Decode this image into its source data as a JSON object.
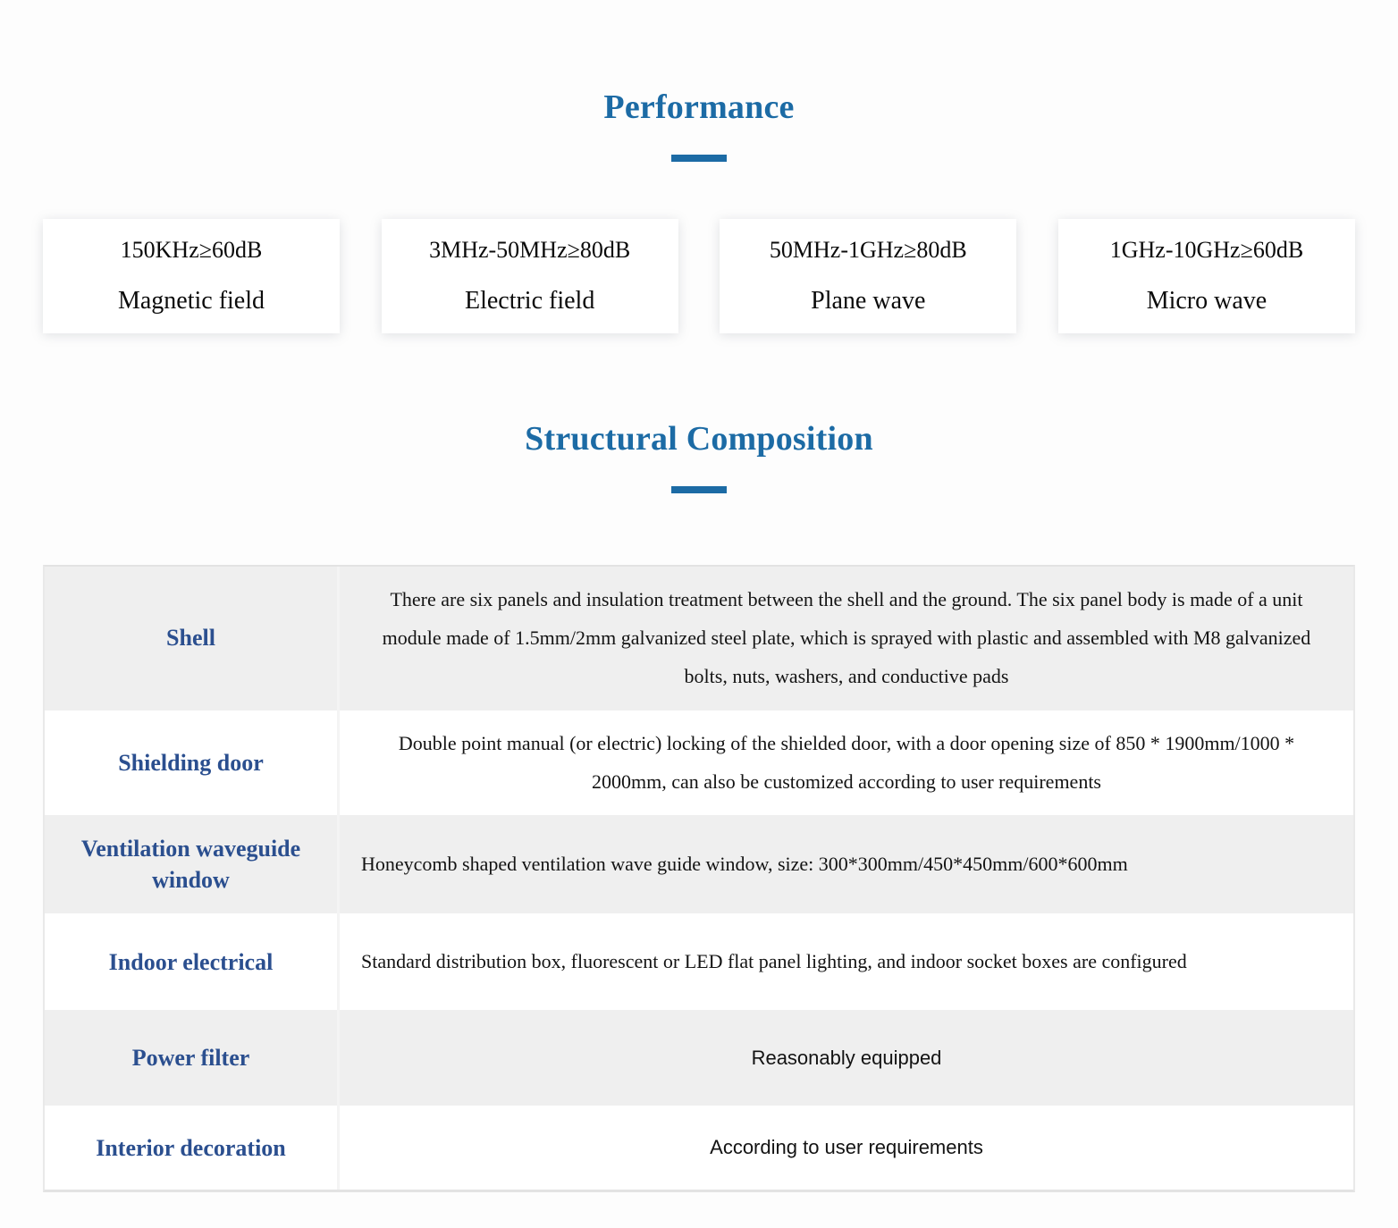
{
  "theme": {
    "heading_blue": "#1c6ba5",
    "label_blue": "#2b4f8f",
    "row_shade": "#efefef",
    "page_background": "#fdfdfd"
  },
  "performance": {
    "title": "Performance",
    "cards": [
      {
        "spec": "150KHz≥60dB",
        "label": "Magnetic field"
      },
      {
        "spec": "3MHz-50MHz≥80dB",
        "label": "Electric field"
      },
      {
        "spec": "50MHz-1GHz≥80dB",
        "label": "Plane wave"
      },
      {
        "spec": "1GHz-10GHz≥60dB",
        "label": "Micro wave"
      }
    ]
  },
  "structural_composition": {
    "title": "Structural Composition",
    "rows": [
      {
        "label": "Shell",
        "description": "There are six panels and insulation treatment between the shell and the ground. The six panel body is made of a unit module made of 1.5mm/2mm galvanized steel plate, which is sprayed with plastic and assembled with M8 galvanized bolts, nuts, washers, and conductive pads"
      },
      {
        "label": "Shielding door",
        "description": "Double point manual (or electric) locking of the shielded door, with a door opening size of 850 * 1900mm/1000 * 2000mm, can also be customized according to user requirements"
      },
      {
        "label": "Ventilation waveguide window",
        "description": "Honeycomb shaped ventilation wave guide window, size: 300*300mm/450*450mm/600*600mm"
      },
      {
        "label": "Indoor electrical",
        "description": "Standard distribution box, fluorescent or LED flat panel lighting, and indoor socket boxes are configured"
      },
      {
        "label": "Power filter",
        "description": "Reasonably equipped"
      },
      {
        "label": "Interior decoration",
        "description": "According to user requirements"
      }
    ]
  }
}
